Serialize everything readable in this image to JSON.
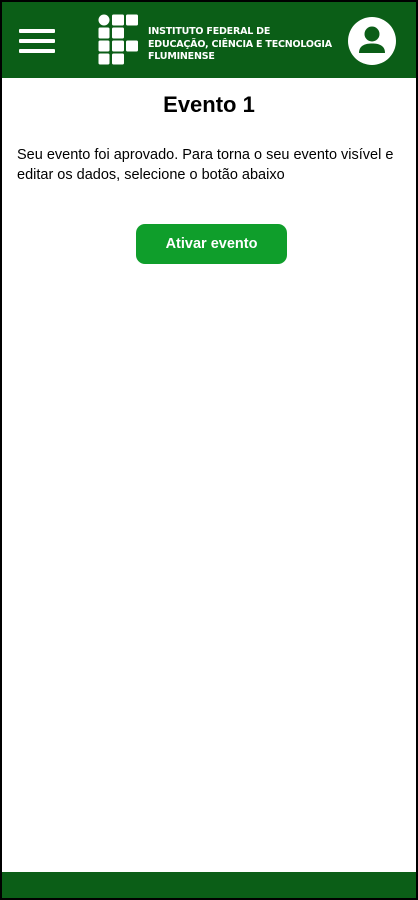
{
  "header": {
    "menu_icon": "hamburger-menu-icon",
    "logo_icon": "ifluminense-logo-icon",
    "institution_lines": [
      "INSTITUTO FEDERAL DE",
      "EDUCAÇÃO, CIÊNCIA E TECNOLOGIA",
      "FLUMINENSE"
    ],
    "profile_icon": "user-avatar-icon",
    "background_color": "#0b5e17"
  },
  "main": {
    "title": "Evento 1",
    "description": "Seu evento foi aprovado. Para torna o seu evento visível e editar os dados, selecione o botão abaixo",
    "activate_button_label": "Ativar evento",
    "button_color": "#0f9e2b"
  },
  "footer": {
    "background_color": "#0b5e17"
  }
}
